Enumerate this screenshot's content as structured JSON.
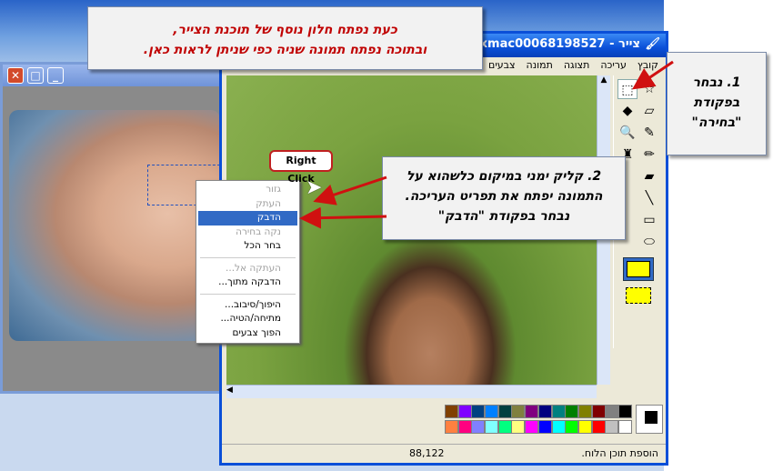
{
  "main_window": {
    "title": "Pixmac00068198527 - צייר",
    "menu": [
      "קובץ",
      "עריכה",
      "תצוגה",
      "תמונה",
      "צבעים"
    ],
    "status_text": "הוספת תוכן הלוח.",
    "coordinates": "88,122"
  },
  "left_window": {
    "buttons": [
      "close-icon",
      "maximize-icon",
      "minimize-icon"
    ]
  },
  "context_menu": {
    "items": [
      {
        "label": "גזור",
        "enabled": false
      },
      {
        "label": "העתק",
        "enabled": false
      },
      {
        "label": "הדבק",
        "enabled": true,
        "highlighted": true
      },
      {
        "label": "נקה בחירה",
        "enabled": false
      },
      {
        "label": "בחר הכל",
        "enabled": true
      },
      {
        "sep": true
      },
      {
        "label": "העתקה אל...",
        "enabled": false
      },
      {
        "label": "הדבקה מתוך...",
        "enabled": true
      },
      {
        "sep": true
      },
      {
        "label": "היפוך/סיבוב...",
        "enabled": true
      },
      {
        "label": "מתיחה/הטיה...",
        "enabled": true
      },
      {
        "label": "הפוך צבעים",
        "enabled": true
      }
    ]
  },
  "callouts": {
    "top": [
      "כעת נפתח חלון נוסף של תוכנת הצייר,",
      "ובתוכה נפתח תמונה שניה כפי שניתן לראות כאן."
    ],
    "step1": [
      "1. נבחר",
      "בפקודת",
      "\"בחירה\""
    ],
    "step2": [
      "2. קליק ימני במיקום כלשהוא על",
      "התמונה יפתח את תפריט העריכה.",
      "נבחר בפקודת \"הדבק\""
    ],
    "right_click": "Right Click"
  },
  "palette": {
    "top": [
      "#000000",
      "#808080",
      "#800000",
      "#808000",
      "#008000",
      "#008080",
      "#000080",
      "#800080",
      "#808040",
      "#004040",
      "#0080ff",
      "#004080",
      "#8000ff",
      "#804000"
    ],
    "bottom": [
      "#ffffff",
      "#c0c0c0",
      "#ff0000",
      "#ffff00",
      "#00ff00",
      "#00ffff",
      "#0000ff",
      "#ff00ff",
      "#ffff80",
      "#00ff80",
      "#80ffff",
      "#8080ff",
      "#ff0080",
      "#ff8040"
    ],
    "foreground": "#000000",
    "background": "#ffffff"
  },
  "tools": [
    "free-select",
    "rect-select",
    "eraser",
    "fill",
    "color-picker",
    "magnifier",
    "pencil",
    "brush",
    "airbrush",
    "text",
    "curve",
    "line",
    "rectangle",
    "polygon",
    "rounded-rect",
    "ellipse"
  ]
}
